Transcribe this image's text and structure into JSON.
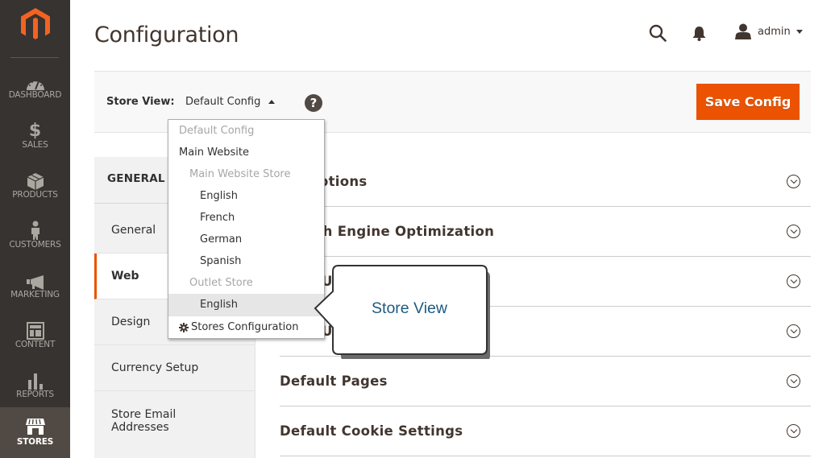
{
  "sidebar": {
    "logo": "magento-logo",
    "items": [
      {
        "label": "DASHBOARD",
        "icon": "dashboard-gauge-icon",
        "active": false
      },
      {
        "label": "SALES",
        "icon": "dollar-icon",
        "active": false
      },
      {
        "label": "PRODUCTS",
        "icon": "box-icon",
        "active": false
      },
      {
        "label": "CUSTOMERS",
        "icon": "person-icon",
        "active": false
      },
      {
        "label": "MARKETING",
        "icon": "megaphone-icon",
        "active": false
      },
      {
        "label": "CONTENT",
        "icon": "layout-icon",
        "active": false
      },
      {
        "label": "REPORTS",
        "icon": "bar-chart-icon",
        "active": false
      },
      {
        "label": "STORES",
        "icon": "storefront-icon",
        "active": true
      }
    ]
  },
  "header": {
    "title": "Configuration",
    "search_icon": "search-icon",
    "notifications_icon": "bell-icon",
    "user": {
      "name": "admin",
      "icon": "user-icon"
    }
  },
  "scope": {
    "label": "Store View:",
    "current": "Default Config",
    "help_icon": "?",
    "save_label": "Save Config",
    "accent": "#eb5202"
  },
  "scope_dropdown": {
    "items": [
      {
        "label": "Default Config",
        "level": 0,
        "disabled": true
      },
      {
        "label": "Main Website",
        "level": 0,
        "disabled": false
      },
      {
        "label": "Main Website Store",
        "level": 1,
        "disabled": true
      },
      {
        "label": "English",
        "level": 2,
        "disabled": false
      },
      {
        "label": "French",
        "level": 2,
        "disabled": false
      },
      {
        "label": "German",
        "level": 2,
        "disabled": false
      },
      {
        "label": "Spanish",
        "level": 2,
        "disabled": false
      },
      {
        "label": "Outlet Store",
        "level": 1,
        "disabled": true
      },
      {
        "label": "English",
        "level": 2,
        "disabled": false,
        "highlighted": true
      }
    ],
    "footer": {
      "label": "Stores Configuration",
      "icon": "gear-icon"
    }
  },
  "tabs": {
    "group": "GENERAL",
    "items": [
      {
        "label": "General",
        "active": false
      },
      {
        "label": "Web",
        "active": true
      },
      {
        "label": "Design",
        "active": false
      },
      {
        "label": "Currency Setup",
        "active": false
      },
      {
        "label": "Store Email Addresses",
        "active": false
      }
    ]
  },
  "sections": [
    {
      "title": "Url Options",
      "visible_fragment": "tions"
    },
    {
      "title": "Search Engine Optimization",
      "visible_fragment": "Engine Optimization"
    },
    {
      "title": "Base URLs",
      "visible_fragment": "UR"
    },
    {
      "title": "Base URLs (Secure)",
      "visible_fragment": "UR"
    },
    {
      "title": "Default Pages",
      "visible_fragment": "Default Pages"
    },
    {
      "title": "Default Cookie Settings",
      "visible_fragment": "Default Cookie Settings"
    }
  ],
  "callout": {
    "text": "Store View"
  }
}
